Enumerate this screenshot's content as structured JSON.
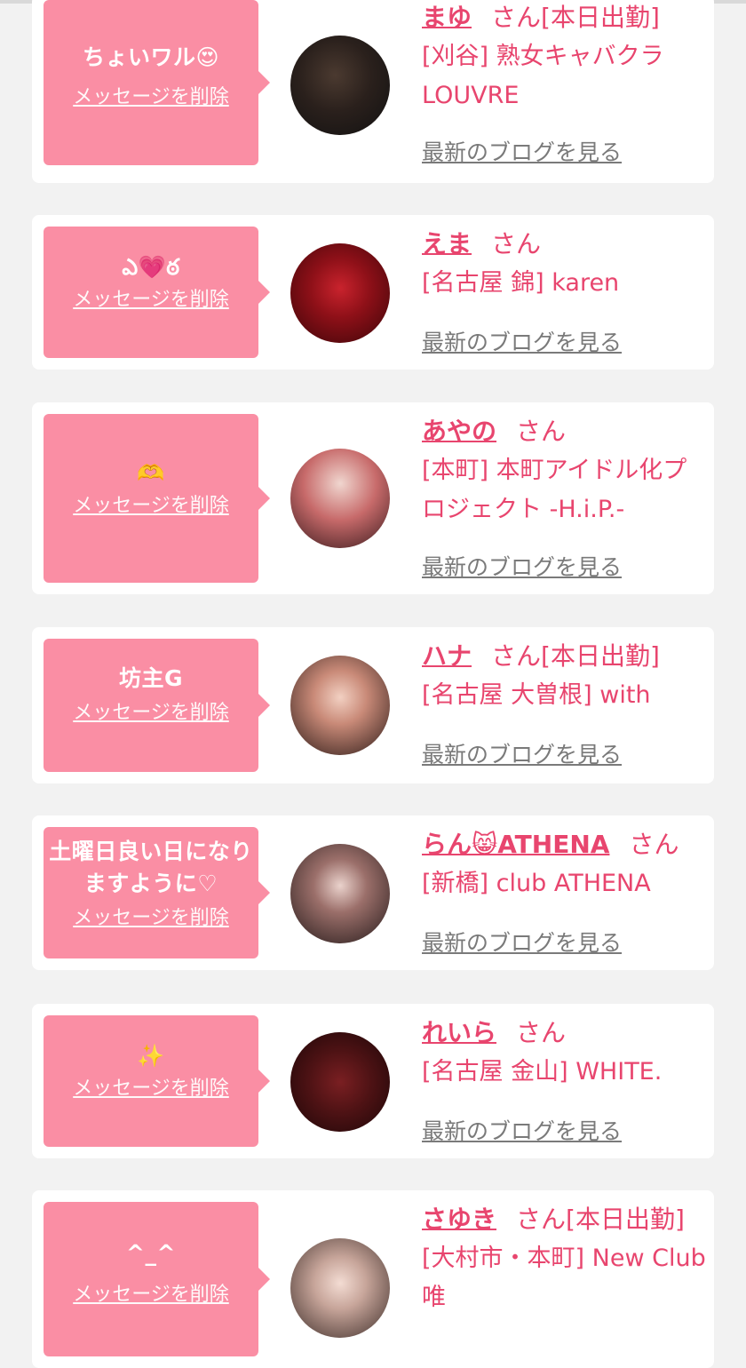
{
  "colors": {
    "accent": "#e8456e",
    "bubble": "#fa8ea4",
    "background": "#f2f2f2",
    "card": "#ffffff",
    "link_gray": "#7a7a7a"
  },
  "labels": {
    "delete": "メッセージを削除",
    "blog": "最新のブログを見る",
    "san": "さん"
  },
  "items": [
    {
      "message": "ちょいワル😍",
      "name": "まゆ",
      "status": "[本日出勤]",
      "shop": "[刈谷] 熟女キャバクラLOUVRE"
    },
    {
      "message": "ఎ💗ఠ",
      "name": "えま",
      "status": "",
      "shop": "[名古屋 錦] karen"
    },
    {
      "message": "🫶",
      "name": "あやの",
      "status": "",
      "shop": "[本町] 本町アイドル化プロジェクト -H.i.P.-"
    },
    {
      "message": "坊主G",
      "name": "ハナ",
      "status": "[本日出勤]",
      "shop": "[名古屋 大曽根] with"
    },
    {
      "message": "土曜日良い日になりますように♡",
      "name": "らん😸ATHENA",
      "status": "",
      "shop": "[新橋] club ATHENA"
    },
    {
      "message": "✨",
      "name": "れいら",
      "status": "",
      "shop": "[名古屋 金山] WHITE."
    },
    {
      "message": "^_^",
      "name": "さゆき",
      "status": "[本日出勤]",
      "shop": "[大村市・本町] New Club 唯"
    }
  ]
}
